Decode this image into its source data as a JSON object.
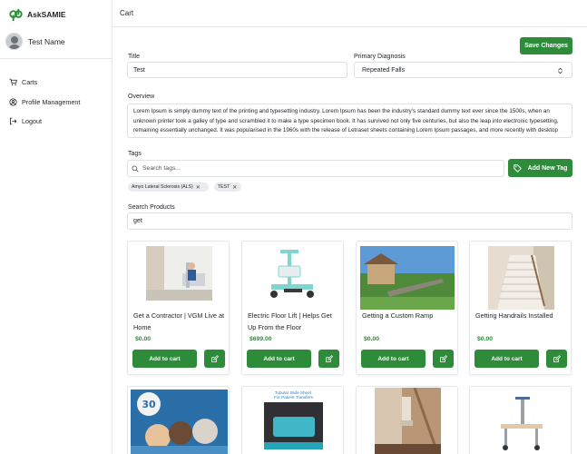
{
  "brand": {
    "name": "AskSAMIE"
  },
  "user": {
    "name": "Test Name"
  },
  "nav": [
    {
      "label": "Carts",
      "icon": "cart-icon"
    },
    {
      "label": "Profile Management",
      "icon": "user-circle-icon"
    },
    {
      "label": "Logout",
      "icon": "logout-icon"
    }
  ],
  "header": {
    "title": "Cart"
  },
  "form": {
    "save_label": "Save Changes",
    "title_label": "Title",
    "title_value": "Test",
    "diagnosis_label": "Primary Diagnosis",
    "diagnosis_value": "Repeated Falls",
    "overview_label": "Overview",
    "overview_value": "Lorem Ipsum is simply dummy text of the printing and typesetting industry. Lorem Ipsum has been the industry's standard dummy text ever since the 1500s, when an unknown printer took a galley of type and scrambled it to make a type specimen book. It has survived not only five centuries, but also the leap into electronic typesetting, remaining essentially unchanged. It was popularised in the 1960s with the release of Letraset sheets containing Lorem Ipsum passages, and more recently with desktop publishing software like Aldus PageMaker including versions of Lorem Ipsum.",
    "tags_label": "Tags",
    "tags_placeholder": "Search tags...",
    "add_tag_label": "Add New Tag",
    "tags": [
      "Amyo Lateral Sclerosis (ALS)",
      "TEST"
    ],
    "search_products_label": "Search Products",
    "search_products_value": "get"
  },
  "products": [
    {
      "title": "Get a Contractor | VGM Live at Home",
      "price": "$0.00",
      "add_label": "Add to cart"
    },
    {
      "title": "Electric Floor Lift | Helps Get Up From the Floor",
      "price": "$699.00",
      "add_label": "Add to cart"
    },
    {
      "title": "Getting a Custom Ramp",
      "price": "$0.00",
      "add_label": "Add to cart"
    },
    {
      "title": "Getting Handrails Installed",
      "price": "$0.00",
      "add_label": "Add to cart"
    }
  ],
  "products_row2": [
    {
      "image_text": "30"
    },
    {
      "image_text": "Tubular Slide Sheet For Patient Transfers"
    },
    {
      "image_text": ""
    },
    {
      "image_text": ""
    }
  ],
  "colors": {
    "accent": "#2e8b3a",
    "border": "#dfe1e5"
  }
}
